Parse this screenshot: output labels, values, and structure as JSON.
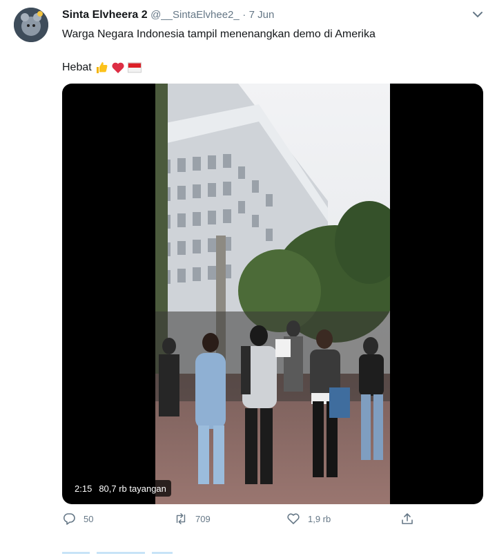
{
  "tweet": {
    "display_name": "Sinta Elvheera 2",
    "handle": "@__SintaElvhee2_",
    "separator": "·",
    "time": "7 Jun",
    "text_line1": "Warga Negara Indonesia tampil menenangkan demo di Amerika",
    "text_line2": "Hebat",
    "emojis": [
      "thumbs-up-icon",
      "heart-icon",
      "indonesia-flag-icon"
    ]
  },
  "video": {
    "duration": "2:15",
    "views": "80,7 rb tayangan"
  },
  "actions": {
    "replies": "50",
    "retweets": "709",
    "likes": "1,9 rb"
  },
  "colors": {
    "text": "#14171a",
    "muted": "#657786",
    "accent": "#1da1f2",
    "heart": "#e0245e"
  }
}
